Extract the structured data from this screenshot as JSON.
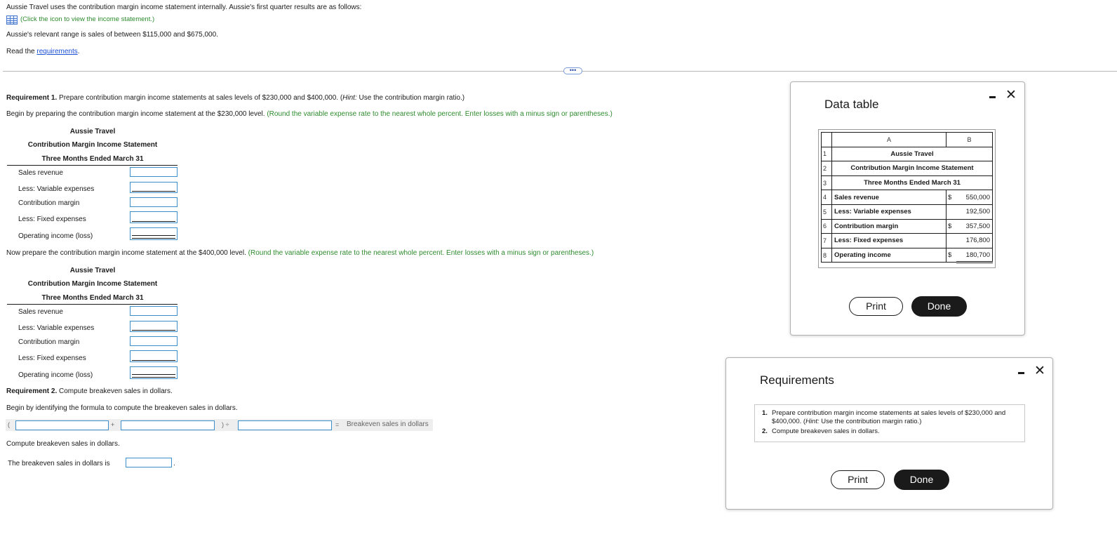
{
  "intro": {
    "line1": "Aussie Travel uses the contribution margin income statement internally. Aussie's first quarter results are as follows:",
    "icon_link": "(Click the icon to view the income statement.)",
    "range": "Aussie's relevant range is sales of between $115,000 and $675,000.",
    "read_prefix": "Read the ",
    "read_link": "requirements",
    "read_suffix": "."
  },
  "more_button": "•••",
  "req1": {
    "label": "Requirement 1.",
    "text_a": " Prepare contribution margin income statements at sales levels of $230,000 and $400,000. (",
    "hint": "Hint:",
    "text_b": " Use the contribution margin ratio.)",
    "begin": "Begin by preparing the contribution margin income statement at the $230,000 level.",
    "begin_note": " (Round the variable expense rate to the nearest whole percent. Enter losses with a minus sign or parentheses.)",
    "now": "Now prepare the contribution margin income statement at the $400,000 level.",
    "now_note": " (Round the variable expense rate to the nearest whole percent. Enter losses with a minus sign or parentheses.)"
  },
  "statement": {
    "company": "Aussie Travel",
    "title": "Contribution Margin Income Statement",
    "period": "Three Months Ended March 31",
    "rows": [
      "Sales revenue",
      "Less: Variable expenses",
      "Contribution margin",
      "Less: Fixed expenses",
      "Operating income (loss)"
    ]
  },
  "req2": {
    "label": "Requirement 2.",
    "text": " Compute breakeven sales in dollars.",
    "begin": "Begin by identifying the formula to compute the breakeven sales in dollars.",
    "open_paren": "(",
    "plus": "+",
    "close_div": ") ÷",
    "equals": "=",
    "result_label": "Breakeven sales in dollars",
    "compute": "Compute breakeven sales in dollars.",
    "answer_prefix": "The breakeven sales in dollars is",
    "answer_suffix": "."
  },
  "data_modal": {
    "title": "Data table",
    "col_a": "A",
    "col_b": "B",
    "rows": [
      {
        "n": "1",
        "text": "Aussie Travel"
      },
      {
        "n": "2",
        "text": "Contribution Margin Income Statement"
      },
      {
        "n": "3",
        "text": "Three Months Ended March 31"
      },
      {
        "n": "4",
        "label": "Sales revenue",
        "cur": "$",
        "value": "550,000"
      },
      {
        "n": "5",
        "label": "Less: Variable expenses",
        "cur": "",
        "value": "192,500"
      },
      {
        "n": "6",
        "label": "Contribution margin",
        "cur": "$",
        "value": "357,500"
      },
      {
        "n": "7",
        "label": "Less: Fixed expenses",
        "cur": "",
        "value": "176,800"
      },
      {
        "n": "8",
        "label": "Operating income",
        "cur": "$",
        "value": "180,700"
      }
    ],
    "print": "Print",
    "done": "Done",
    "close": "✕"
  },
  "req_modal": {
    "title": "Requirements",
    "item1_num": "1.",
    "item1_a": "Prepare contribution margin income statements at sales levels of $230,000 and $400,000. (",
    "item1_hint": "Hint:",
    "item1_b": " Use the contribution margin ratio.)",
    "item2_num": "2.",
    "item2": "Compute breakeven sales in dollars.",
    "print": "Print",
    "done": "Done",
    "close": "✕"
  }
}
